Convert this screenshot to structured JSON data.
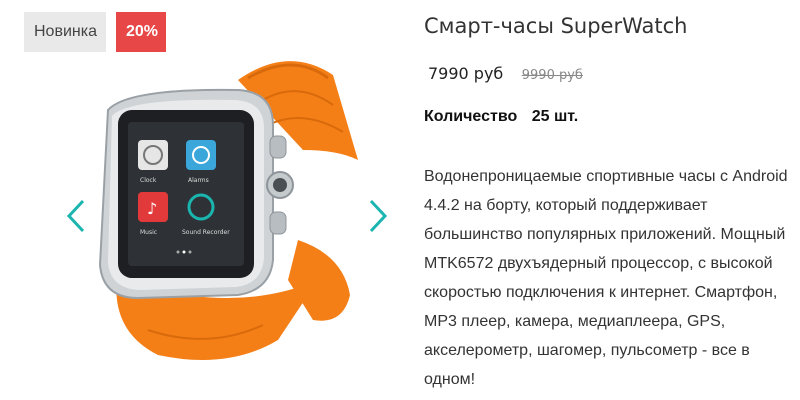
{
  "badges": {
    "new": "Новинка",
    "discount": "20%"
  },
  "product": {
    "title": "Смарт-часы SuperWatch",
    "price": "7990 руб",
    "old_price": "9990 руб",
    "quantity_label": "Количество",
    "quantity_value": "25 шт.",
    "description": "Водонепроницаемые спортивные часы с Android 4.4.2 на борту, который поддерживает большинство популярных приложений. Мощный MTK6572 двухъядерный процессор, с высокой скоростью подключения к интернет. Смартфон, MP3 плеер, камера, медиаплеера, GPS, акселерометр, шагомер, пульсометр - все в одном!"
  },
  "watch_screen": {
    "apps": [
      "Clock",
      "Alarms",
      "Music",
      "Sound Recorder"
    ]
  },
  "colors": {
    "accent": "#1bb5b0",
    "sale": "#e84747",
    "strap": "#f57f17"
  }
}
